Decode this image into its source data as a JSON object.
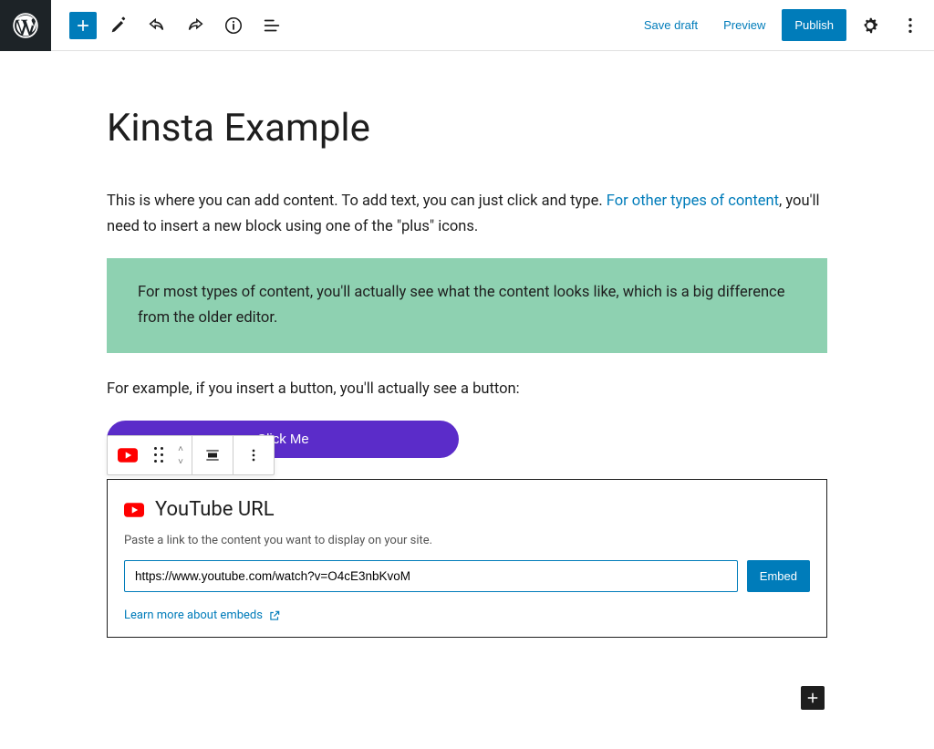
{
  "toolbar": {
    "save_draft": "Save draft",
    "preview": "Preview",
    "publish": "Publish"
  },
  "post": {
    "title": "Kinsta Example",
    "intro_part1": "This is where you can add content. To add text, you can just click and type. ",
    "intro_link": "For other types of content",
    "intro_part2": ", you'll need to insert a new block using one of the \"plus\" icons.",
    "callout": "For most types of content, you'll actually see what the content looks like, which is a big difference from the older editor.",
    "para2": "For example, if you insert a button, you'll actually see a button:",
    "button_label": "Click Me"
  },
  "embed": {
    "title": "YouTube URL",
    "desc": "Paste a link to the content you want to display on your site.",
    "url_value": "https://www.youtube.com/watch?v=O4cE3nbKvoM",
    "embed_btn": "Embed",
    "learn_more": "Learn more about embeds"
  }
}
